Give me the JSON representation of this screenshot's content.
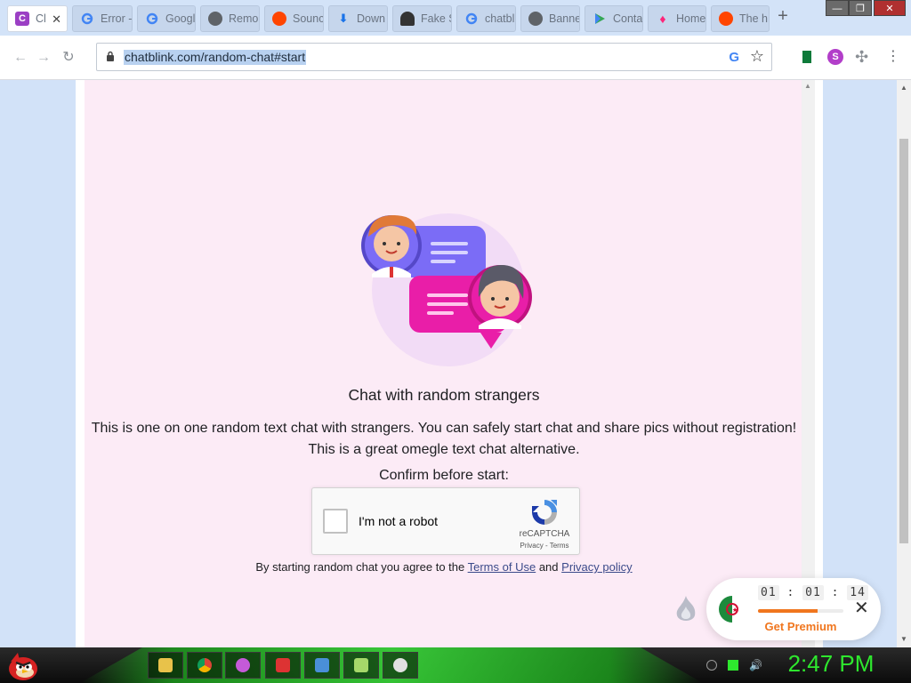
{
  "browser": {
    "tabs": [
      {
        "title": "Cl",
        "favicon": "chatblink-icon",
        "favicon_color": "#9b3fc4",
        "favicon_text": "C",
        "active": true
      },
      {
        "title": "Error -",
        "favicon": "google-icon"
      },
      {
        "title": "Googl",
        "favicon": "google-icon"
      },
      {
        "title": "Remo",
        "favicon": "globe-icon"
      },
      {
        "title": "Sounc",
        "favicon": "reddit-icon"
      },
      {
        "title": "Down",
        "favicon": "download-icon"
      },
      {
        "title": "Fake S",
        "favicon": "user-icon"
      },
      {
        "title": "chatbl",
        "favicon": "google-icon"
      },
      {
        "title": "Banne",
        "favicon": "globe-icon"
      },
      {
        "title": "Conta",
        "favicon": "play-store-icon"
      },
      {
        "title": "Home",
        "favicon": "tinder-icon"
      },
      {
        "title": "The h",
        "favicon": "reddit-icon"
      }
    ],
    "new_tab_label": "+",
    "url": "chatblink.com/random-chat#start",
    "omnibox_icons": {
      "google": "G",
      "bookmark": "☆"
    }
  },
  "page": {
    "headline": "Chat with random strangers",
    "description_line1": "This is one on one random text chat with strangers. You can safely start chat and share pics without registration!",
    "description_line2": "This is a great omegle text chat alternative.",
    "confirm_text": "Confirm before start:",
    "recaptcha": {
      "label": "I'm not a robot",
      "brand": "reCAPTCHA",
      "links": "Privacy - Terms"
    },
    "agree": {
      "prefix": "By starting random chat you agree to the",
      "terms_link": "Terms of Use",
      "and": "and",
      "privacy_link": "Privacy policy"
    }
  },
  "premium_widget": {
    "timer": {
      "hours": "01",
      "minutes": "01",
      "seconds": "14",
      "separator": ":"
    },
    "progress_fraction": 0.7,
    "cta": "Get Premium",
    "close": "✕",
    "accent_color": "#f0761e"
  },
  "taskbar": {
    "clock": "2:47 PM",
    "apps": [
      "file-explorer-icon",
      "chrome-icon",
      "app-icon",
      "media-player-icon",
      "window-icon",
      "notes-icon",
      "paint-icon"
    ]
  }
}
